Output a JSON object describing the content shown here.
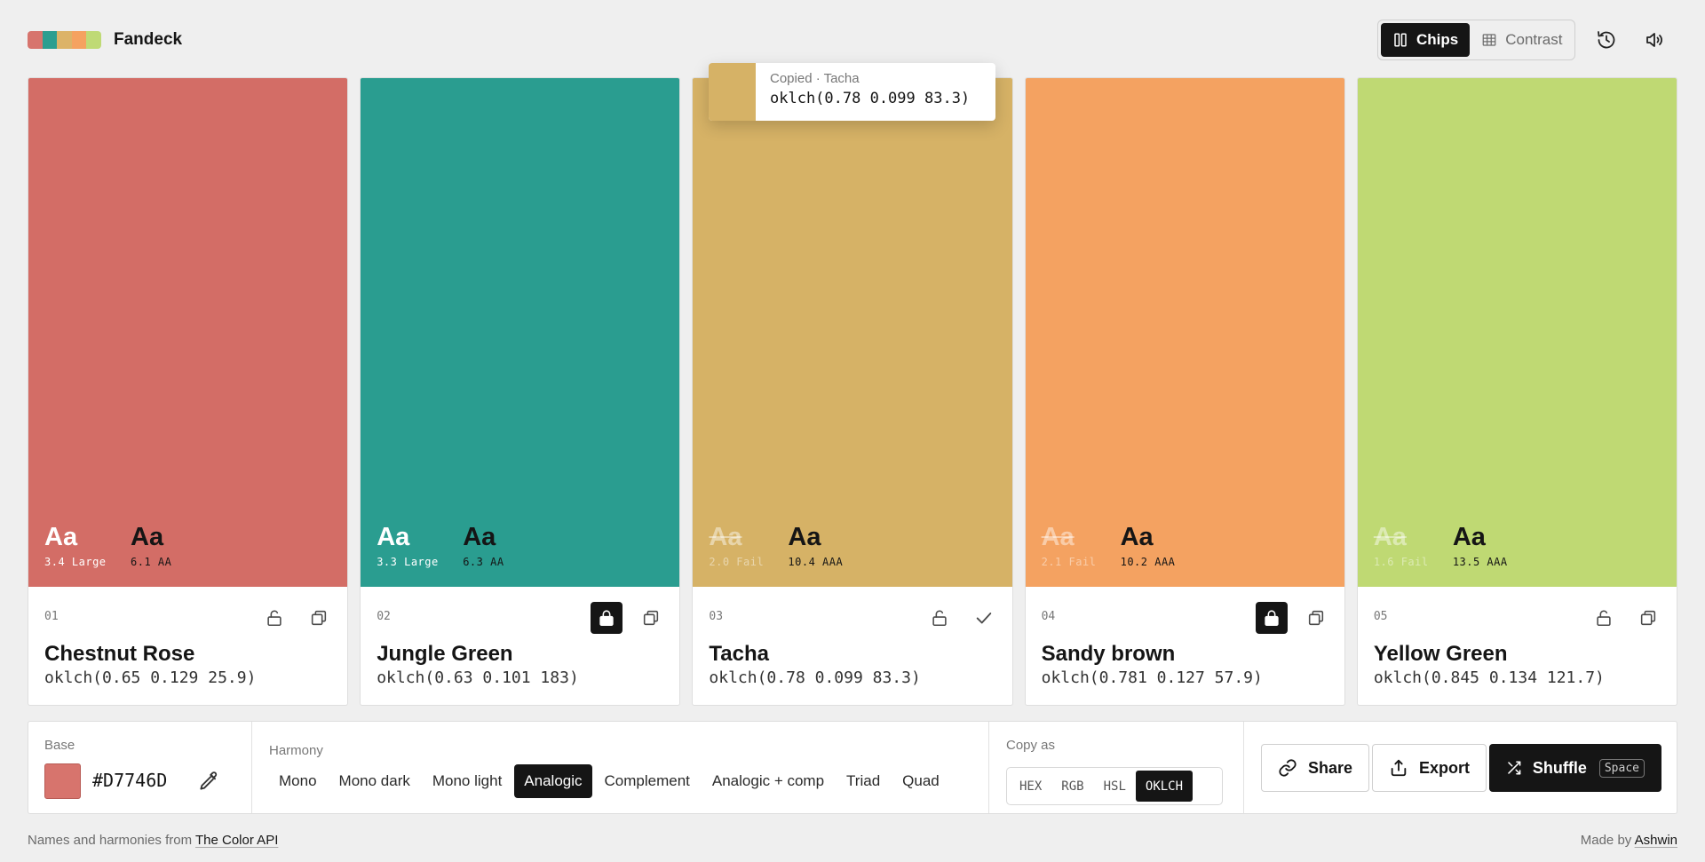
{
  "app": {
    "title": "Fandeck",
    "logo_colors": [
      "#D7746D",
      "#2C9E90",
      "#DCB368",
      "#F5A260",
      "#BFDA75"
    ]
  },
  "header": {
    "views": [
      {
        "label": "Chips",
        "icon": "columns-icon",
        "active": true
      },
      {
        "label": "Contrast",
        "icon": "grid-icon",
        "active": false
      }
    ],
    "icons": [
      "history-icon",
      "sound-icon"
    ]
  },
  "cards": [
    {
      "index": "01",
      "name": "Chestnut Rose",
      "value": "oklch(0.65 0.129 25.9)",
      "color": "#D36D66",
      "locked": false,
      "copied": false,
      "contrast_light": {
        "label": "Aa",
        "ratio": "3.4 Large",
        "fail": false
      },
      "contrast_dark": {
        "label": "Aa",
        "ratio": "6.1 AA",
        "fail": false
      }
    },
    {
      "index": "02",
      "name": "Jungle Green",
      "value": "oklch(0.63 0.101 183)",
      "color": "#2A9D90",
      "locked": true,
      "copied": false,
      "contrast_light": {
        "label": "Aa",
        "ratio": "3.3 Large",
        "fail": false
      },
      "contrast_dark": {
        "label": "Aa",
        "ratio": "6.3 AA",
        "fail": false
      }
    },
    {
      "index": "03",
      "name": "Tacha",
      "value": "oklch(0.78 0.099 83.3)",
      "color": "#D6B266",
      "locked": false,
      "copied": true,
      "contrast_light": {
        "label": "Aa",
        "ratio": "2.0 Fail",
        "fail": true
      },
      "contrast_dark": {
        "label": "Aa",
        "ratio": "10.4 AAA",
        "fail": false
      }
    },
    {
      "index": "04",
      "name": "Sandy brown",
      "value": "oklch(0.781 0.127 57.9)",
      "color": "#F4A261",
      "locked": true,
      "copied": false,
      "contrast_light": {
        "label": "Aa",
        "ratio": "2.1 Fail",
        "fail": true
      },
      "contrast_dark": {
        "label": "Aa",
        "ratio": "10.2 AAA",
        "fail": false
      }
    },
    {
      "index": "05",
      "name": "Yellow Green",
      "value": "oklch(0.845 0.134 121.7)",
      "color": "#BFD973",
      "locked": false,
      "copied": false,
      "contrast_light": {
        "label": "Aa",
        "ratio": "1.6 Fail",
        "fail": true
      },
      "contrast_dark": {
        "label": "Aa",
        "ratio": "13.5 AAA",
        "fail": false
      }
    }
  ],
  "tooltip": {
    "title": "Copied · Tacha",
    "value": "oklch(0.78 0.099 83.3)",
    "color": "#D6B266"
  },
  "toolbar": {
    "base": {
      "label": "Base",
      "hex": "#D7746D",
      "color": "#D7746D"
    },
    "harmony": {
      "label": "Harmony",
      "options": [
        "Mono",
        "Mono dark",
        "Mono light",
        "Analogic",
        "Complement",
        "Analogic + comp",
        "Triad",
        "Quad"
      ],
      "selected": "Analogic"
    },
    "copy_as": {
      "label": "Copy as",
      "options": [
        "HEX",
        "RGB",
        "HSL",
        "OKLCH"
      ],
      "selected": "OKLCH"
    },
    "share_label": "Share",
    "export_label": "Export",
    "shuffle_label": "Shuffle",
    "shuffle_key": "Space"
  },
  "footer": {
    "left_text": "Names and harmonies from",
    "left_link": "The Color API",
    "right_text": "Made by",
    "right_link": "Ashwin"
  }
}
